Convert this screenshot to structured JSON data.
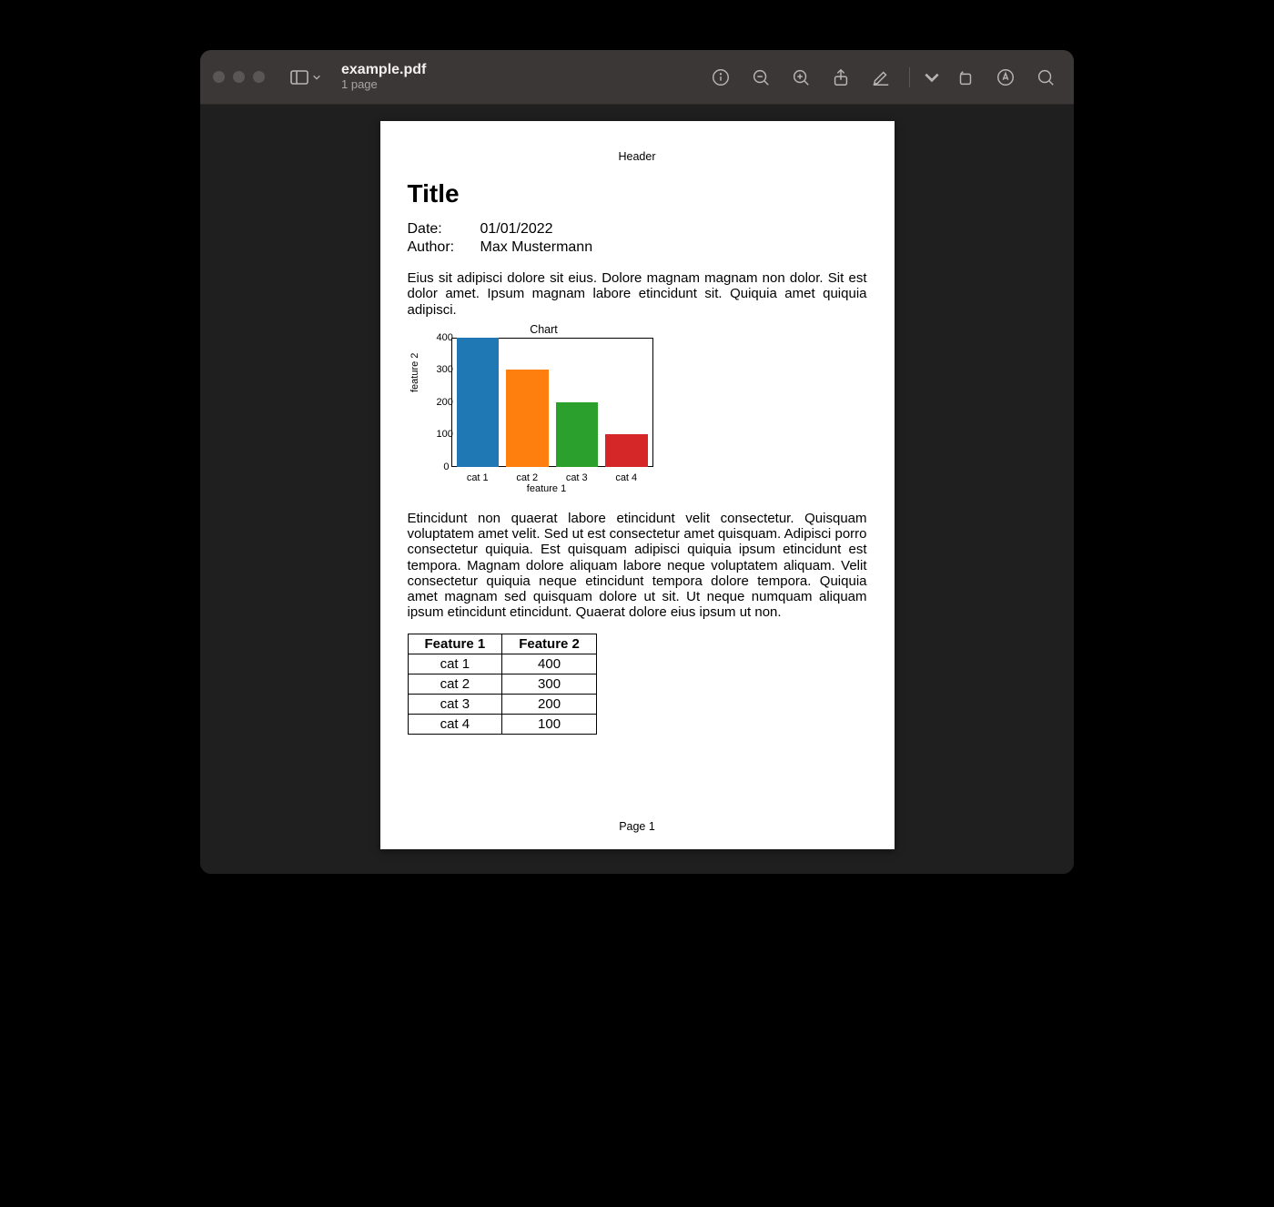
{
  "window": {
    "filename": "example.pdf",
    "subtitle": "1 page"
  },
  "doc": {
    "header": "Header",
    "title": "Title",
    "meta": {
      "date_label": "Date:",
      "date_value": "01/01/2022",
      "author_label": "Author:",
      "author_value": "Max Mustermann"
    },
    "para1": "Eius sit adipisci dolore sit eius. Dolore magnam magnam non dolor. Sit est dolor amet. Ipsum magnam labore etincidunt sit. Quiquia amet quiquia adipisci.",
    "para2": "Etincidunt non quaerat labore etincidunt velit consectetur. Quisquam voluptatem amet velit. Sed ut est consectetur amet quisquam. Adipisci porro consectetur quiquia. Est quisquam adipisci quiquia ipsum etincidunt est tempora. Magnam dolore aliquam labore neque voluptatem aliquam. Velit consectetur quiquia neque etincidunt tempora dolore tempora. Quiquia amet magnam sed quisquam dolore ut sit. Ut neque numquam aliquam ipsum etincidunt etincidunt. Quaerat dolore eius ipsum ut non.",
    "table": {
      "headers": [
        "Feature 1",
        "Feature 2"
      ],
      "rows": [
        [
          "cat 1",
          "400"
        ],
        [
          "cat 2",
          "300"
        ],
        [
          "cat 3",
          "200"
        ],
        [
          "cat 4",
          "100"
        ]
      ]
    },
    "footer": "Page 1"
  },
  "chart_data": {
    "type": "bar",
    "title": "Chart",
    "xlabel": "feature 1",
    "ylabel": "feature 2",
    "categories": [
      "cat 1",
      "cat 2",
      "cat 3",
      "cat 4"
    ],
    "values": [
      400,
      300,
      200,
      100
    ],
    "ylim": [
      0,
      400
    ],
    "yticks": [
      0,
      100,
      200,
      300,
      400
    ],
    "colors": [
      "#1f77b4",
      "#ff7f0e",
      "#2ca02c",
      "#d62728"
    ]
  }
}
